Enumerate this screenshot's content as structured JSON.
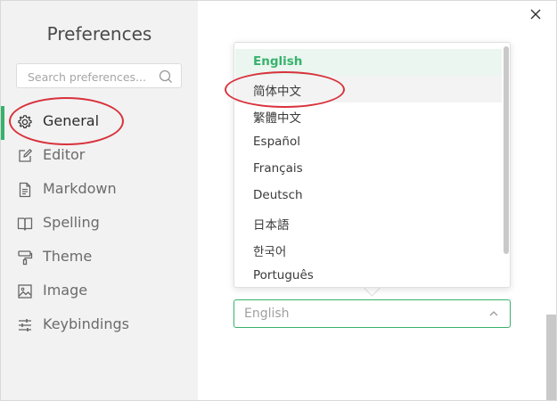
{
  "window": {
    "title": "Preferences"
  },
  "sidebar": {
    "title": "Preferences",
    "search": {
      "placeholder": "Search preferences...",
      "value": ""
    },
    "items": [
      {
        "label": "General",
        "icon": "gear-icon",
        "active": true
      },
      {
        "label": "Editor",
        "icon": "edit-icon",
        "active": false
      },
      {
        "label": "Markdown",
        "icon": "document-icon",
        "active": false
      },
      {
        "label": "Spelling",
        "icon": "book-icon",
        "active": false
      },
      {
        "label": "Theme",
        "icon": "paint-roller-icon",
        "active": false
      },
      {
        "label": "Image",
        "icon": "image-icon",
        "active": false
      },
      {
        "label": "Keybindings",
        "icon": "sliders-icon",
        "active": false
      }
    ]
  },
  "language": {
    "options": [
      {
        "label": "English",
        "selected": true
      },
      {
        "label": "简体中文",
        "selected": false
      },
      {
        "label": "繁體中文",
        "selected": false
      },
      {
        "label": "Español",
        "selected": false
      },
      {
        "label": "Français",
        "selected": false
      },
      {
        "label": "Deutsch",
        "selected": false
      },
      {
        "label": "日本語",
        "selected": false
      },
      {
        "label": "한국어",
        "selected": false
      },
      {
        "label": "Português",
        "selected": false
      }
    ],
    "current_value": "English"
  },
  "colors": {
    "accent": "#37b26c",
    "annotation_red": "#d8323c",
    "sidebar_bg": "#f2f2f2"
  }
}
